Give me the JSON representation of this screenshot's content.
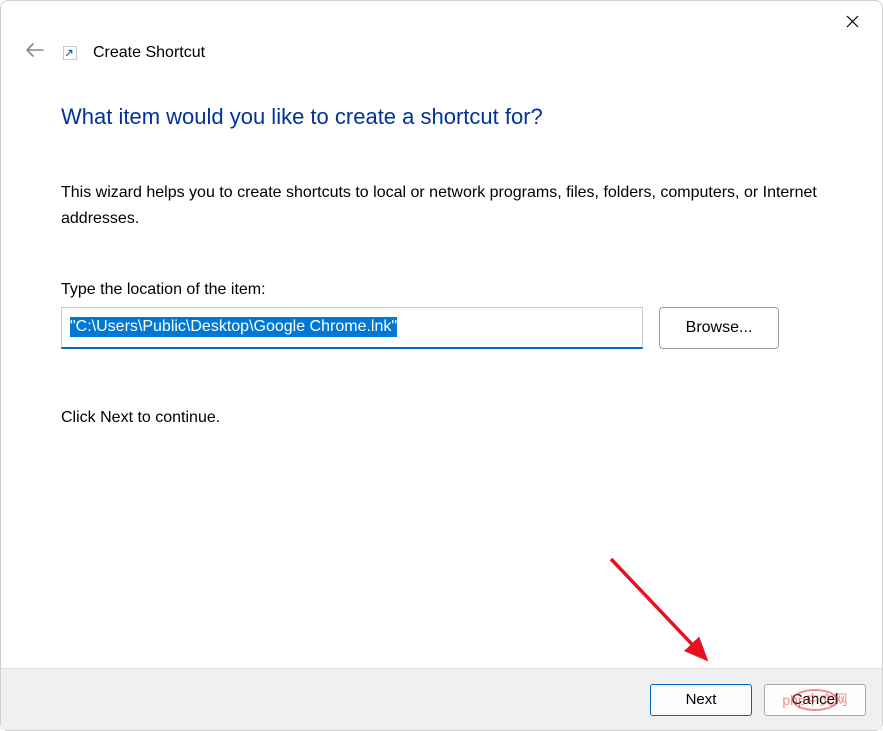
{
  "header": {
    "title": "Create Shortcut"
  },
  "main": {
    "heading": "What item would you like to create a shortcut for?",
    "description": "This wizard helps you to create shortcuts to local or network programs, files, folders, computers, or Internet addresses.",
    "location_label": "Type the location of the item:",
    "location_value": "\"C:\\Users\\Public\\Desktop\\Google Chrome.lnk\"",
    "browse_label": "Browse...",
    "continue_text": "Click Next to continue."
  },
  "footer": {
    "next_label": "Next",
    "cancel_label": "Cancel"
  },
  "annotation": {
    "watermark_text": "php中文网"
  }
}
